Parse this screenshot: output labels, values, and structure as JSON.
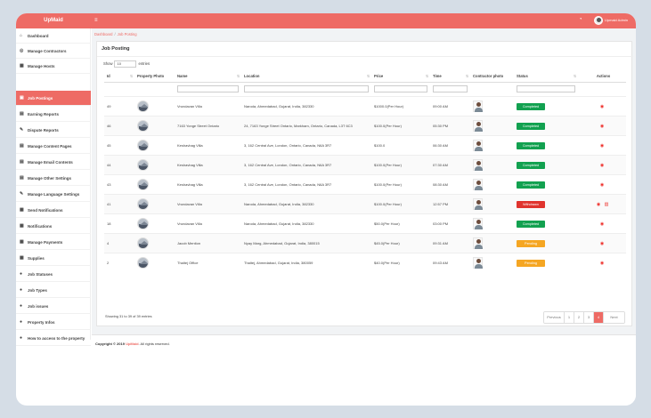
{
  "app": {
    "brand": "UpMaid",
    "user_name": "Upmaid Admin"
  },
  "colors": {
    "accent": "#ee6b65",
    "completed": "#12a150",
    "withdrawn": "#e0342e",
    "pending": "#f5a623"
  },
  "icons": {
    "menu": "hamburger-icon",
    "notification": "bell-icon",
    "view": "eye-icon",
    "delete": "trash-icon"
  },
  "sidebar": {
    "items": [
      {
        "icon": "dashboard-icon",
        "label": "Dashboard",
        "active": false
      },
      {
        "icon": "contractors-icon",
        "label": "Manage Contractors",
        "active": false
      },
      {
        "icon": "hosts-icon",
        "label": "Manage Hosts",
        "active": false
      },
      {
        "icon": "briefcase-icon",
        "label": "Job Postings",
        "active": true
      },
      {
        "icon": "report-icon",
        "label": "Earning Reports",
        "active": false
      },
      {
        "icon": "dispute-icon",
        "label": "Dispute Reports",
        "active": false
      },
      {
        "icon": "pages-icon",
        "label": "Manage Content Pages",
        "active": false
      },
      {
        "icon": "email-icon",
        "label": "Manage Email Contents",
        "active": false
      },
      {
        "icon": "settings-icon",
        "label": "Manage Other Settings",
        "active": false
      },
      {
        "icon": "language-icon",
        "label": "Manage Language Settings",
        "active": false
      },
      {
        "icon": "send-icon",
        "label": "Send Notifications",
        "active": false
      },
      {
        "icon": "notifications-icon",
        "label": "Notifications",
        "active": false
      },
      {
        "icon": "payments-icon",
        "label": "Manage Payments",
        "active": false
      },
      {
        "icon": "supplies-icon",
        "label": "Supplies",
        "active": false
      },
      {
        "icon": "statuses-icon",
        "label": "Job Statuses",
        "active": false
      },
      {
        "icon": "types-icon",
        "label": "Job Types",
        "active": false
      },
      {
        "icon": "issues-icon",
        "label": "Job issues",
        "active": false
      },
      {
        "icon": "property-info-icon",
        "label": "Property Infos",
        "active": false
      },
      {
        "icon": "help-icon",
        "label": "How to access to the property",
        "active": false
      }
    ]
  },
  "breadcrumb": {
    "home": "Dashboard",
    "separator": "/",
    "current": "Job Posting"
  },
  "page": {
    "title": "Job Posting",
    "show_label": "Show",
    "entries_value": "10",
    "entries_label": "entries"
  },
  "table": {
    "columns": [
      "Id",
      "Property Photo",
      "Name",
      "Location",
      "Price",
      "Time",
      "Contractor photo",
      "Status",
      "Actions"
    ],
    "rows": [
      {
        "id": "49",
        "name": "Vrundavan Villa",
        "location": "Naroda, Ahmedabad, Gujarat, India, 382330",
        "price": "$1000.0(Per Hour)",
        "time": "09:00 AM",
        "status": "Completed",
        "status_type": "completed",
        "delete": false
      },
      {
        "id": "46",
        "name": "7163 Yonge Street Ontario",
        "location": "24, 7163 Yonge Street Ontario, Markham, Ontario, Canada, L3T 6C3",
        "price": "$100.0(Per Hour)",
        "time": "05:30 PM",
        "status": "Completed",
        "status_type": "completed",
        "delete": false
      },
      {
        "id": "45",
        "name": "Keshavbag Villa",
        "location": "3, 162 Central Ave, London, Ontario, Canada, N6A 3R7",
        "price": "$100.0",
        "time": "06:30 AM",
        "status": "Completed",
        "status_type": "completed",
        "delete": false
      },
      {
        "id": "44",
        "name": "Keshavbag Villa",
        "location": "3, 162 Central Ave, London, Ontario, Canada, N6A 3R7",
        "price": "$100.0(Per Hour)",
        "time": "07:30 AM",
        "status": "Completed",
        "status_type": "completed",
        "delete": false
      },
      {
        "id": "43",
        "name": "Keshavbag Villa",
        "location": "3, 162 Central Ave, London, Ontario, Canada, N6A 3R7",
        "price": "$100.0(Per Hour)",
        "time": "08:30 AM",
        "status": "Completed",
        "status_type": "completed",
        "delete": false
      },
      {
        "id": "41",
        "name": "Vrundavan Villa",
        "location": "Naroda, Ahmedabad, Gujarat, India, 382330",
        "price": "$100.0(Per Hour)",
        "time": "12:57 PM",
        "status": "Withdrawn",
        "status_type": "withdrawn",
        "delete": true
      },
      {
        "id": "18",
        "name": "Vrundavan Villa",
        "location": "Naroda, Ahmedabad, Gujarat, India, 382330",
        "price": "$50.0(Per Hour)",
        "time": "03:00 PM",
        "status": "Completed",
        "status_type": "completed",
        "delete": false
      },
      {
        "id": "4",
        "name": "Jacob Mention",
        "location": "Nyay Marg, Ahmedabad, Gujarat, India, 380015",
        "price": "$45.0(Per Hour)",
        "time": "09:31 AM",
        "status": "Pending",
        "status_type": "pending",
        "delete": false
      },
      {
        "id": "2",
        "name": "Thaltej Office",
        "location": "Thaltej, Ahmedabad, Gujarat, India, 380059",
        "price": "$40.0(Per Hour)",
        "time": "09:43 AM",
        "status": "Pending",
        "status_type": "pending",
        "delete": false
      }
    ]
  },
  "table_footer": {
    "info": "Showing 31 to 39 of 39 entries"
  },
  "pagination": {
    "items": [
      "Previous",
      "1",
      "2",
      "3",
      "4",
      "Next"
    ],
    "current": "4"
  },
  "footer": {
    "prefix": "Copyright © 2019",
    "brand": "UpMaid",
    "suffix": ". All rights reserved."
  }
}
